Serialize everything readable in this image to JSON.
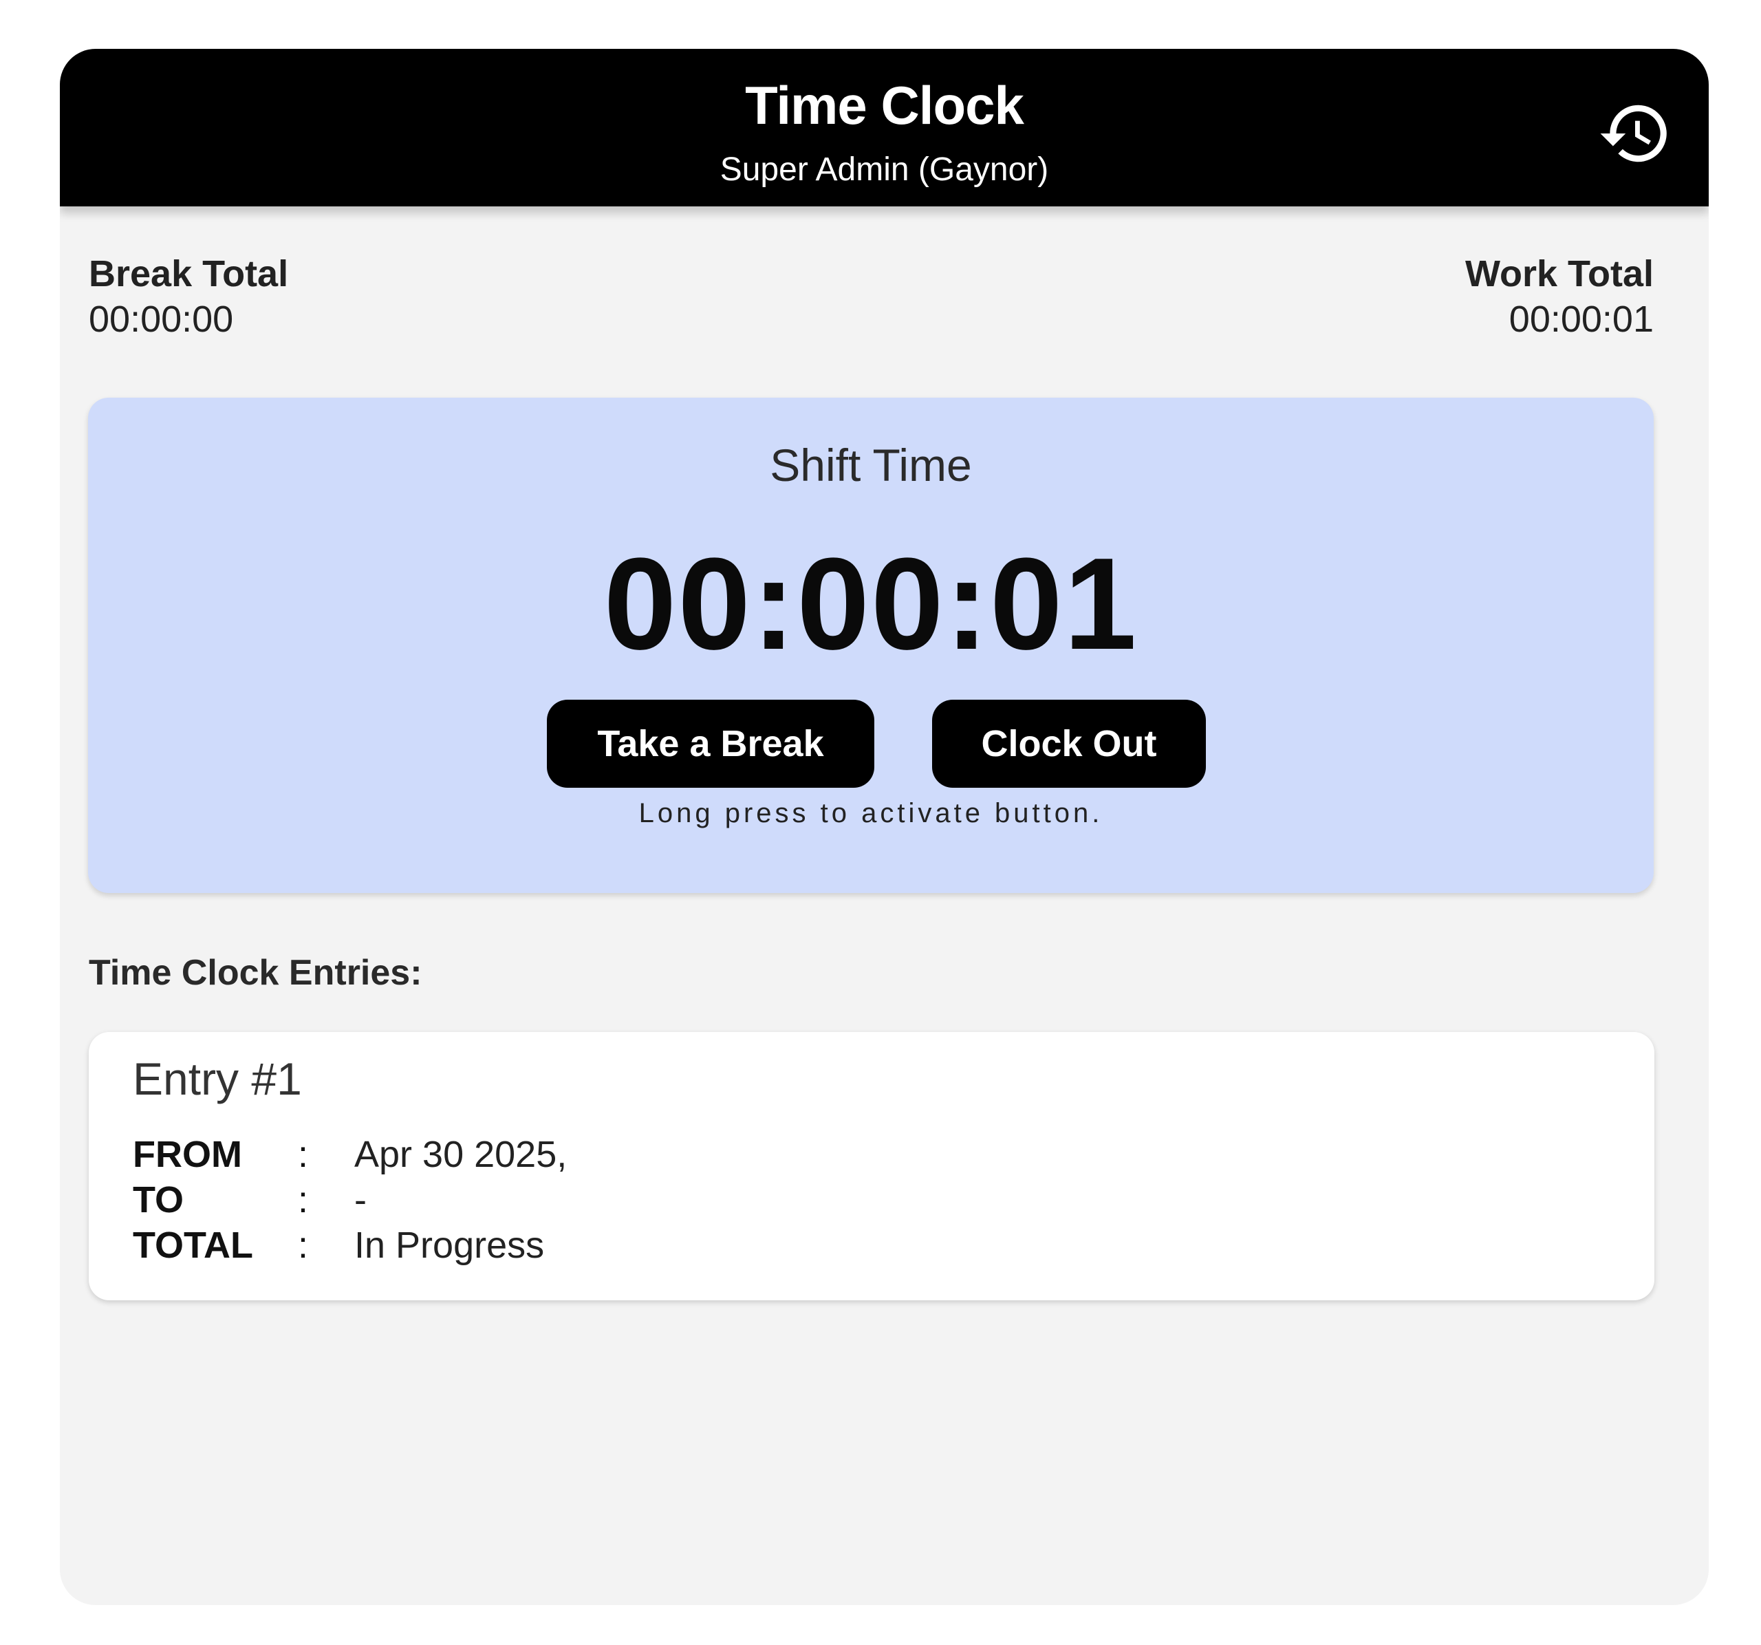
{
  "header": {
    "title": "Time Clock",
    "subtitle": "Super Admin (Gaynor)",
    "history_icon": "history-icon"
  },
  "totals": {
    "break_label": "Break Total",
    "break_value": "00:00:00",
    "work_label": "Work Total",
    "work_value": "00:00:01"
  },
  "shift": {
    "label": "Shift Time",
    "time": "00:00:01",
    "break_button": "Take a Break",
    "clock_out_button": "Clock Out",
    "hint": "Long press to activate button."
  },
  "entries": {
    "heading": "Time Clock Entries:",
    "items": [
      {
        "title": "Entry #1",
        "rows": [
          {
            "key": "FROM",
            "sep": ":",
            "value": "Apr 30 2025,"
          },
          {
            "key": "TO",
            "sep": ":",
            "value": "-"
          },
          {
            "key": "TOTAL",
            "sep": ":",
            "value": "In Progress"
          }
        ]
      }
    ]
  },
  "colors": {
    "header_bg": "#000000",
    "panel_bg": "#f3f3f3",
    "shift_card_bg": "#cfdbfb",
    "button_bg": "#000000"
  }
}
